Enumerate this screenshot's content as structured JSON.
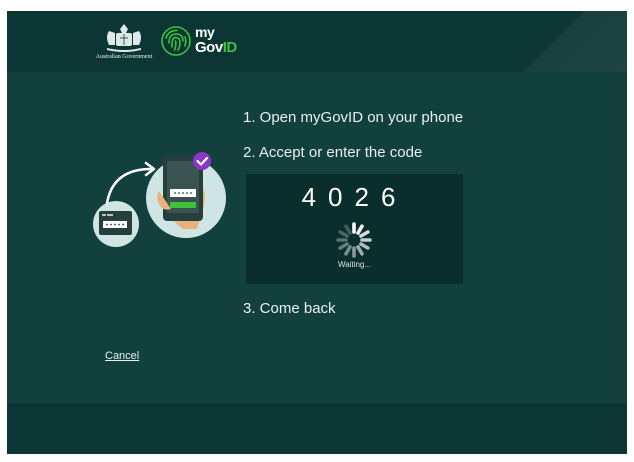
{
  "header": {
    "gov_label": "Australian Government",
    "logo_my": "my",
    "logo_gov": "Gov",
    "logo_id": "ID"
  },
  "steps": {
    "step1": "1. Open myGovID on your phone",
    "step2": "2. Accept or enter the code",
    "step3": "3. Come back"
  },
  "code": {
    "digits": "4026",
    "status": "Waiting..."
  },
  "actions": {
    "cancel_label": "Cancel"
  },
  "colors": {
    "background": "#11403d",
    "header": "#0c3633",
    "code_box": "#0a2e2c",
    "accent_green": "#3fc23b",
    "accent_purple": "#8b35c9"
  },
  "icons": {
    "crest": "australian-coat-of-arms-icon",
    "logo": "fingerprint-icon",
    "spinner": "loading-spinner-icon",
    "check": "check-badge-icon"
  }
}
